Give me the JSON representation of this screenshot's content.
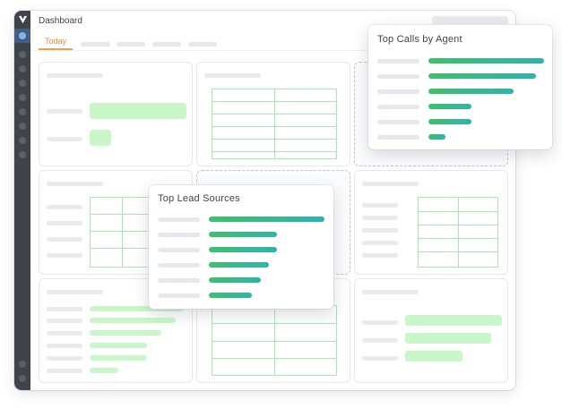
{
  "header": {
    "title": "Dashboard"
  },
  "tabs": {
    "active_label": "Today"
  },
  "colors": {
    "sidebar": "#3f444b",
    "accent_tab": "#f0a04b",
    "active_nav": "#4a90e2",
    "bar_gradient_start": "#3fc06a",
    "bar_gradient_end": "#2fb3ad",
    "placeholder_green": "#c9f7c9"
  },
  "icons": {
    "logo": "brand-logo-icon"
  },
  "popups": {
    "top_calls": {
      "title": "Top Calls by Agent",
      "bar_values": [
        1.0,
        0.93,
        0.74,
        0.37,
        0.37,
        0.15
      ]
    },
    "top_leads": {
      "title": "Top Lead Sources",
      "bar_values": [
        1.0,
        0.59,
        0.59,
        0.52,
        0.45,
        0.37
      ]
    }
  }
}
